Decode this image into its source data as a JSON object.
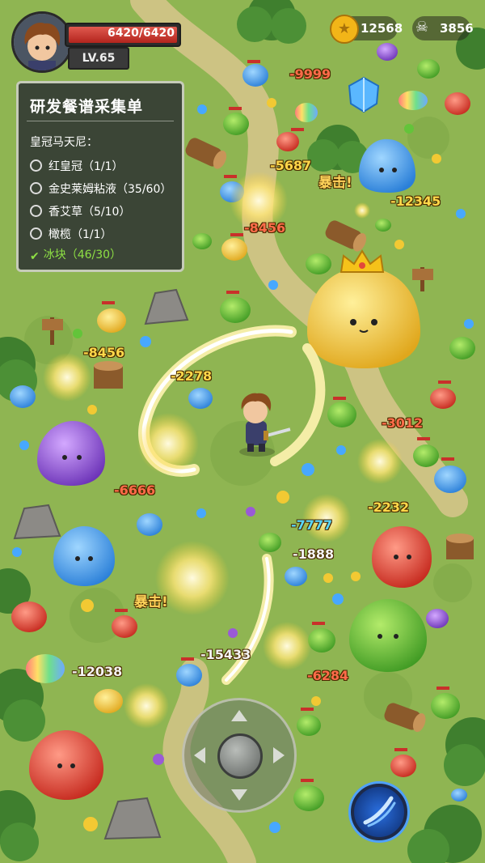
{
  "player": {
    "hp_text": "6420/6420",
    "hp_ratio": 1.0,
    "level_text": "LV.65"
  },
  "resources": {
    "coins": "12568",
    "kills": "3856",
    "coin_icon": "gold-coin-icon",
    "kill_icon": "skull-icon"
  },
  "quest_panel": {
    "title": "研发餐谱采集单",
    "subtitle": "皇冠马天尼：",
    "items": [
      {
        "label": "红皇冠（1/1）",
        "done": false
      },
      {
        "label": "金史莱姆粘液（35/60）",
        "done": false
      },
      {
        "label": "香艾草（5/10）",
        "done": false
      },
      {
        "label": "橄榄（1/1）",
        "done": false
      },
      {
        "label": "冰块（46/30）",
        "done": true
      }
    ],
    "done_mark": "✔"
  },
  "damage_numbers": [
    {
      "text": "-9999",
      "style": "red"
    },
    {
      "text": "-5687",
      "style": "yel"
    },
    {
      "text": "暴击!",
      "style": "crit"
    },
    {
      "text": "-12345",
      "style": "yel"
    },
    {
      "text": "-8456",
      "style": "red"
    },
    {
      "text": "-8456",
      "style": "yel"
    },
    {
      "text": "-2278",
      "style": "yel"
    },
    {
      "text": "-3012",
      "style": "red"
    },
    {
      "text": "-6666",
      "style": "red"
    },
    {
      "text": "-2232",
      "style": "yel"
    },
    {
      "text": "-7777",
      "style": "blu"
    },
    {
      "text": "-1888",
      "style": "wht"
    },
    {
      "text": "暴击!",
      "style": "crit"
    },
    {
      "text": "-15433",
      "style": "wht"
    },
    {
      "text": "-12038",
      "style": "wht"
    },
    {
      "text": "-6284",
      "style": "red"
    }
  ],
  "colors": {
    "grass": "#8fb552",
    "path": "#d8c58c",
    "slime_blue": "#4aa3f0",
    "slime_green": "#63c43a",
    "slime_yellow": "#f2c933",
    "slime_red": "#e2473a",
    "slime_purple": "#9a5ad6",
    "hp_red": "#c9302a"
  },
  "controls": {
    "joystick_icon": "joystick-icon",
    "skill_icon": "blue-slash-skill-icon"
  }
}
